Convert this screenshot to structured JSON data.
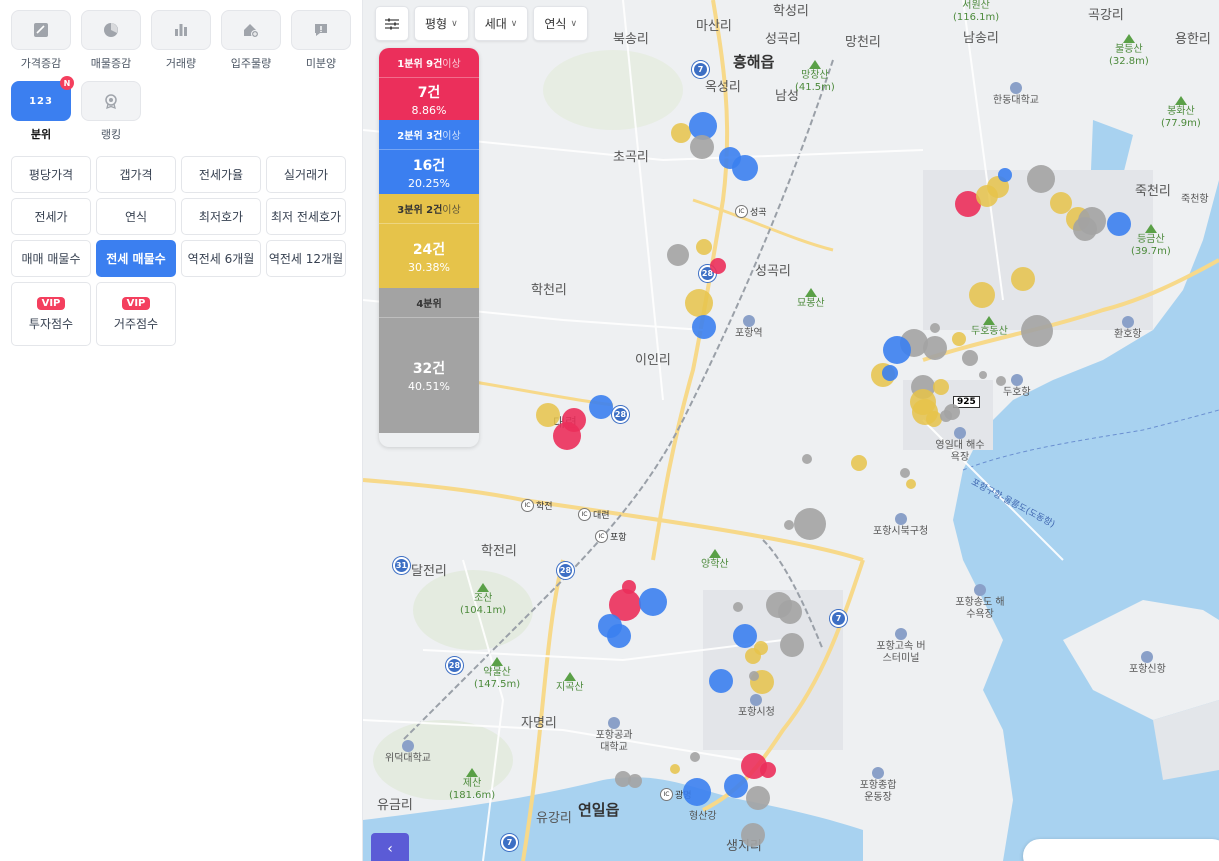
{
  "sidebar": {
    "categories_row1": [
      {
        "name": "price-change",
        "label": "가격증감"
      },
      {
        "name": "listing-change",
        "label": "매물증감"
      },
      {
        "name": "trade-volume",
        "label": "거래량"
      },
      {
        "name": "move-in-volume",
        "label": "입주물량"
      },
      {
        "name": "unsold",
        "label": "미분양"
      }
    ],
    "categories_row2": [
      {
        "name": "quantile",
        "label": "분위",
        "active": true,
        "badge": "N",
        "icon_text": "123"
      },
      {
        "name": "ranking",
        "label": "랭킹"
      }
    ],
    "chips": [
      "평당가격",
      "갭가격",
      "전세가율",
      "실거래가",
      "전세가",
      "연식",
      "최저호가",
      "최저 전세호가",
      "매매 매물수",
      "전세 매물수",
      "역전세 6개월",
      "역전세 12개월"
    ],
    "active_chip": "전세 매물수",
    "vip_badge": "VIP",
    "vip_items": [
      "투자점수",
      "거주점수"
    ]
  },
  "toolbar": {
    "filters": [
      "평형",
      "세대",
      "연식"
    ]
  },
  "legend": {
    "q1": {
      "head_main": "1분위 9건",
      "head_dim": "이상",
      "count": "7건",
      "pct": "8.86%"
    },
    "q2": {
      "head_main": "2분위 3건",
      "head_dim": "이상",
      "count": "16건",
      "pct": "20.25%"
    },
    "q3": {
      "head_main": "3분위 2건",
      "head_dim": "이상",
      "count": "24건",
      "pct": "30.38%"
    },
    "q4": {
      "head_main": "4분위",
      "head_dim": "",
      "count": "32건",
      "pct": "40.51%"
    }
  },
  "colors": {
    "q1": "#eb2f5b",
    "q2": "#3b7ff0",
    "q3": "#e6c34a",
    "q4": "#a3a3a3",
    "accent": "#3b7ff0"
  },
  "map": {
    "places": [
      {
        "t": "마산리"
      },
      {
        "t": "학성리"
      },
      {
        "t": "곡강리"
      },
      {
        "t": "용한리"
      },
      {
        "t": "북송리"
      },
      {
        "t": "흥해읍"
      },
      {
        "t": "성곡리"
      },
      {
        "t": "망천리"
      },
      {
        "t": "남송리"
      },
      {
        "t": "옥성리"
      },
      {
        "t": "남성"
      },
      {
        "t": "초곡리"
      },
      {
        "t": "성곡리"
      },
      {
        "t": "학천리"
      },
      {
        "t": "죽천리"
      },
      {
        "t": "이인리"
      },
      {
        "t": "대련"
      },
      {
        "t": "학전리"
      },
      {
        "t": "달전리"
      },
      {
        "t": "자명리"
      },
      {
        "t": "유금리"
      },
      {
        "t": "유강리"
      },
      {
        "t": "연일읍"
      },
      {
        "t": "생지리"
      }
    ],
    "mountains": [
      {
        "name": "서원산",
        "h": "(116.1m)"
      },
      {
        "name": "불등산",
        "h": "(32.8m)"
      },
      {
        "name": "망창산",
        "h": "(41.5m)"
      },
      {
        "name": "봉화산",
        "h": "(77.9m)"
      },
      {
        "name": "등금산",
        "h": "(39.7m)"
      },
      {
        "name": "묘봉산",
        "h": ""
      },
      {
        "name": "두호동산",
        "h": ""
      },
      {
        "name": "양학산",
        "h": ""
      },
      {
        "name": "조산",
        "h": "(104.1m)"
      },
      {
        "name": "약물산",
        "h": "(147.5m)"
      },
      {
        "name": "지곡산",
        "h": ""
      },
      {
        "name": "제산",
        "h": "(181.6m)"
      }
    ],
    "pois": [
      "한동대학교",
      "포항역",
      "환호항",
      "두호항",
      "영일대 해수욕장",
      "포항시북구청",
      "포항송도 해수욕장",
      "포항고속 버스터미널",
      "포항신항",
      "포항시청",
      "포항공과 대학교",
      "위덕대학교",
      "포항종합 운동장",
      "죽천항",
      "형산강"
    ],
    "road_label": "포항구항-울릉도(도동항)",
    "ic_labels": [
      "성곡",
      "학전",
      "대련",
      "포항",
      "광명"
    ],
    "routes": [
      "7",
      "28",
      "28",
      "28",
      "31",
      "28",
      "7",
      "7",
      "925"
    ]
  }
}
